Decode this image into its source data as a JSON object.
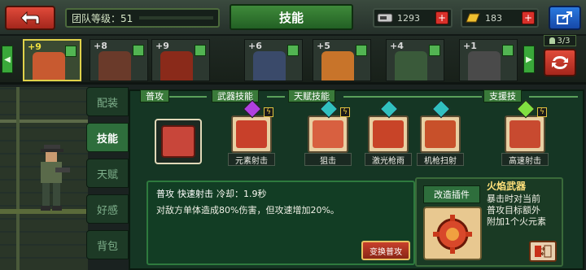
{
  "header": {
    "back_icon": "back-arrow-icon",
    "team_level_label": "团队等级：51",
    "title": "技能",
    "resources": [
      {
        "icon": "device-icon",
        "amount": "1293"
      },
      {
        "icon": "gold-bar-icon",
        "amount": "183"
      }
    ],
    "share_icon": "share-icon"
  },
  "heroes": [
    {
      "stars": "+9",
      "selected": true,
      "color": "#c85a30"
    },
    {
      "stars": "+8",
      "selected": false,
      "color": "#6a3a2a"
    },
    {
      "stars": "+9",
      "selected": false,
      "color": "#8a2a1a"
    },
    {
      "stars": "+6",
      "selected": false,
      "color": "#3a4a6a"
    },
    {
      "stars": "+5",
      "selected": false,
      "color": "#c8742a"
    },
    {
      "stars": "+4",
      "selected": false,
      "color": "#3a5a3a"
    },
    {
      "stars": "+1",
      "selected": false,
      "color": "#4a4a4a"
    }
  ],
  "team_slots": "3/3",
  "tabs": [
    "配装",
    "技能",
    "天赋",
    "好感",
    "背包"
  ],
  "active_tab": "技能",
  "categories": [
    "普攻",
    "武器技能",
    "天赋技能",
    "支援技"
  ],
  "skills": [
    {
      "label": "元素射击",
      "gem_color": "#b040e0",
      "bolt": true
    },
    {
      "label": "狙击",
      "gem_color": "#30c0c0",
      "bolt": true
    },
    {
      "label": "激光枪雨",
      "gem_color": "#30c0c0",
      "bolt": false
    },
    {
      "label": "机枪扫射",
      "gem_color": "#30c0c0",
      "bolt": false
    },
    {
      "label": "高速射击",
      "gem_color": "#80e040",
      "bolt": true
    }
  ],
  "description": {
    "type": "普攻",
    "name": "快速射击",
    "cooldown": "冷却：1.9秒",
    "text": "对敌方单体造成80%伤害，但攻速增加20%。",
    "change_button": "变换普攻"
  },
  "plugin": {
    "tab_label": "改造插件",
    "title": "火焰武器",
    "lines": [
      "暴击时对当前",
      "普攻目标额外",
      "附加1个火元素"
    ]
  }
}
